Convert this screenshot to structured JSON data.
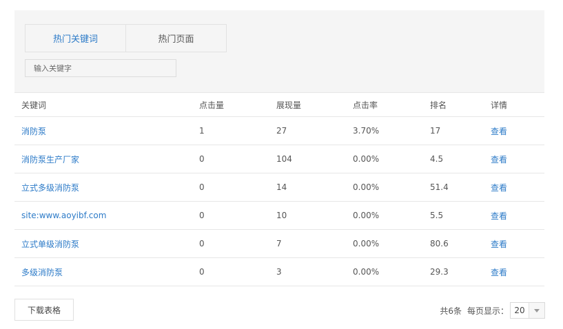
{
  "tabs": [
    {
      "label": "热门关键词",
      "active": true
    },
    {
      "label": "热门页面",
      "active": false
    }
  ],
  "search": {
    "placeholder": "输入关键字",
    "value": ""
  },
  "table": {
    "headers": {
      "keyword": "关键词",
      "clicks": "点击量",
      "impressions": "展现量",
      "ctr": "点击率",
      "rank": "排名",
      "detail": "详情"
    },
    "rows": [
      {
        "keyword": "消防泵",
        "clicks": "1",
        "impressions": "27",
        "ctr": "3.70%",
        "rank": "17",
        "detail": "查看"
      },
      {
        "keyword": "消防泵生产厂家",
        "clicks": "0",
        "impressions": "104",
        "ctr": "0.00%",
        "rank": "4.5",
        "detail": "查看"
      },
      {
        "keyword": "立式多级消防泵",
        "clicks": "0",
        "impressions": "14",
        "ctr": "0.00%",
        "rank": "51.4",
        "detail": "查看"
      },
      {
        "keyword": "site:www.aoyibf.com",
        "clicks": "0",
        "impressions": "10",
        "ctr": "0.00%",
        "rank": "5.5",
        "detail": "查看"
      },
      {
        "keyword": "立式单级消防泵",
        "clicks": "0",
        "impressions": "7",
        "ctr": "0.00%",
        "rank": "80.6",
        "detail": "查看"
      },
      {
        "keyword": "多级消防泵",
        "clicks": "0",
        "impressions": "3",
        "ctr": "0.00%",
        "rank": "29.3",
        "detail": "查看"
      }
    ]
  },
  "footer": {
    "download_label": "下载表格",
    "total_text": "共6条",
    "per_page_label": "每页显示：",
    "per_page_value": "20"
  },
  "icons": {
    "dropdown": "chevron-down-icon"
  },
  "colors": {
    "link": "#2d7bc8",
    "panel_bg": "#f5f5f5",
    "border": "#e6e6e6"
  }
}
